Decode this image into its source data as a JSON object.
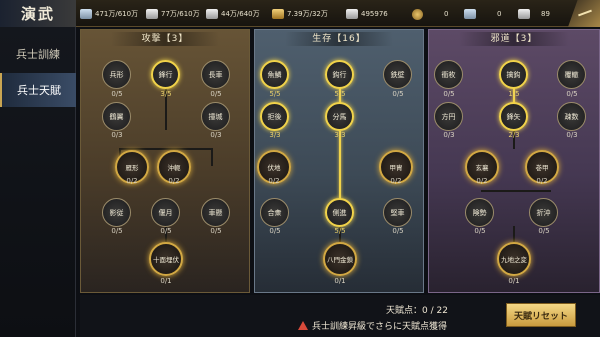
{
  "app": {
    "logo_text": "演武"
  },
  "resources": [
    {
      "icon": "soldier-icon",
      "text": "471万/610万"
    },
    {
      "icon": "food-icon",
      "text": "77万/610万"
    },
    {
      "icon": "iron-icon",
      "text": "44万/640万"
    },
    {
      "icon": "gold-ingot-icon",
      "text": "7.39万/32万"
    },
    {
      "icon": "scroll-icon",
      "text": "495976"
    },
    {
      "icon": "coin-icon",
      "text": "0"
    },
    {
      "icon": "jade-icon",
      "text": "0"
    },
    {
      "icon": "silver-ingot-icon",
      "text": "89"
    }
  ],
  "sidebar": {
    "items": [
      {
        "label": "兵士訓練",
        "active": false
      },
      {
        "label": "兵士天賦",
        "active": true
      }
    ]
  },
  "panels": {
    "attack": {
      "title": "攻撃【3】",
      "nodes": [
        {
          "name": "兵形",
          "count": "0/5"
        },
        {
          "name": "鋒行",
          "count": "3/5"
        },
        {
          "name": "長車",
          "count": "0/5"
        },
        {
          "name": "鶴翼",
          "count": "0/3"
        },
        {
          "name": "撞城",
          "count": "0/3"
        },
        {
          "name": "雁形",
          "count": "0/2"
        },
        {
          "name": "沖軛",
          "count": "0/2"
        },
        {
          "name": "影従",
          "count": "0/5"
        },
        {
          "name": "偃月",
          "count": "0/5"
        },
        {
          "name": "車懸",
          "count": "0/5"
        },
        {
          "name": "十面埋伏",
          "count": "0/1"
        }
      ]
    },
    "survive": {
      "title": "生存【16】",
      "nodes": [
        {
          "name": "魚鱗",
          "count": "5/5"
        },
        {
          "name": "鈎行",
          "count": "5/5"
        },
        {
          "name": "鉄壁",
          "count": "0/5"
        },
        {
          "name": "拒後",
          "count": "3/3"
        },
        {
          "name": "分馬",
          "count": "3/3"
        },
        {
          "name": "伏地",
          "count": "0/2"
        },
        {
          "name": "甲胄",
          "count": "0/2"
        },
        {
          "name": "合衆",
          "count": "0/5"
        },
        {
          "name": "側進",
          "count": "5/5"
        },
        {
          "name": "堅車",
          "count": "0/5"
        },
        {
          "name": "八門金鎖",
          "count": "0/1"
        }
      ]
    },
    "evil": {
      "title": "邪道【3】",
      "nodes": [
        {
          "name": "衝枚",
          "count": "0/5"
        },
        {
          "name": "擒鈎",
          "count": "1/5"
        },
        {
          "name": "覆轍",
          "count": "0/5"
        },
        {
          "name": "方円",
          "count": "0/3"
        },
        {
          "name": "鋒矢",
          "count": "2/3"
        },
        {
          "name": "疎数",
          "count": "0/3"
        },
        {
          "name": "玄襄",
          "count": "0/2"
        },
        {
          "name": "巻甲",
          "count": "0/2"
        },
        {
          "name": "険勢",
          "count": "0/5"
        },
        {
          "name": "折沖",
          "count": "0/5"
        },
        {
          "name": "九地之変",
          "count": "0/1"
        }
      ]
    }
  },
  "footer": {
    "points_text": "天賦点：0 / 22",
    "warning_text": "兵士訓練昇級でさらに天賦点獲得",
    "reset_label": "天賦リセット"
  }
}
